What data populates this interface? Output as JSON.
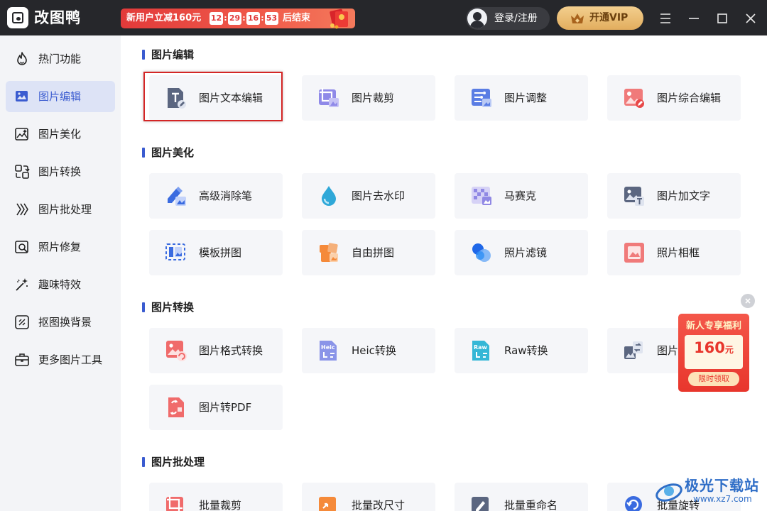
{
  "app": {
    "name": "改图鸭"
  },
  "promo": {
    "text": "新用户立减160元",
    "timer": [
      "12",
      "29",
      "16",
      "53"
    ],
    "after": "后结束"
  },
  "user": {
    "login_label": "登录/注册"
  },
  "vip": {
    "label": "开通VIP"
  },
  "colors": {
    "accent": "#3a5bd0",
    "titlebar": "#26272b",
    "highlight": "#d42626",
    "promo": "#e8362c"
  },
  "sidebar": {
    "items": [
      {
        "label": "热门功能",
        "icon": "flame-icon"
      },
      {
        "label": "图片编辑",
        "icon": "image-edit-icon",
        "active": true
      },
      {
        "label": "图片美化",
        "icon": "image-beautify-icon"
      },
      {
        "label": "图片转换",
        "icon": "convert-icon"
      },
      {
        "label": "图片批处理",
        "icon": "batch-icon"
      },
      {
        "label": "照片修复",
        "icon": "photo-repair-icon"
      },
      {
        "label": "趣味特效",
        "icon": "magic-wand-icon"
      },
      {
        "label": "抠图换背景",
        "icon": "cutout-icon"
      },
      {
        "label": "更多图片工具",
        "icon": "toolbox-icon"
      }
    ]
  },
  "sections": [
    {
      "title": "图片编辑",
      "cards": [
        "图片文本编辑",
        "图片裁剪",
        "图片调整",
        "图片综合编辑"
      ]
    },
    {
      "title": "图片美化",
      "cards": [
        "高级消除笔",
        "图片去水印",
        "马赛克",
        "图片加文字",
        "模板拼图",
        "自由拼图",
        "照片滤镜",
        "照片相框"
      ]
    },
    {
      "title": "图片转换",
      "cards": [
        "图片格式转换",
        "Heic转换",
        "Raw转换",
        "图片",
        "图片转PDF"
      ]
    },
    {
      "title": "图片批处理",
      "cards": [
        "批量裁剪",
        "批量改尺寸",
        "批量重命名",
        "批量旋转"
      ]
    }
  ],
  "ad": {
    "title": "新人专享福利",
    "amount": "160",
    "unit": "元",
    "button": "限时领取"
  },
  "watermark": {
    "text": "极光下载站",
    "url": "www.xz7.com"
  }
}
